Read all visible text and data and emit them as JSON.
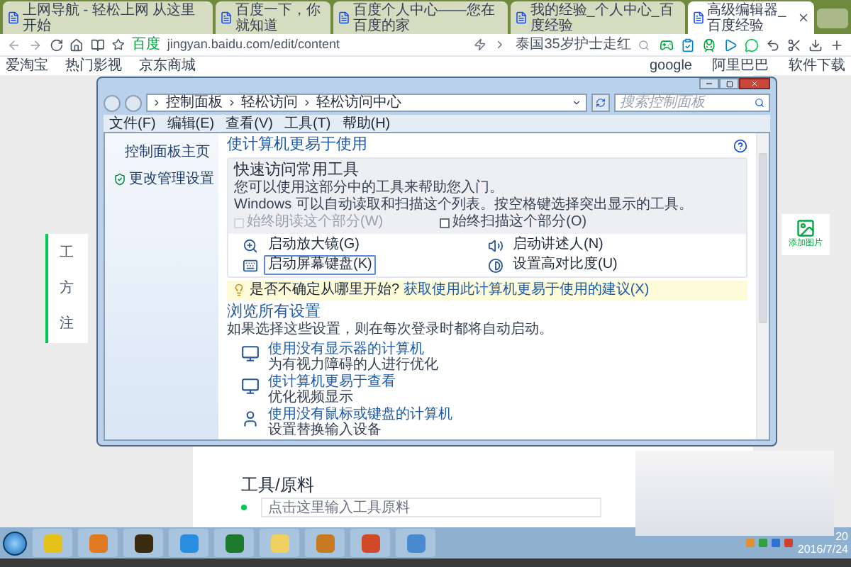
{
  "browser": {
    "tabs": [
      {
        "title": "上网导航 - 轻松上网 从这里开始",
        "selected": false
      },
      {
        "title": "百度一下，你就知道",
        "selected": false
      },
      {
        "title": "百度个人中心——您在百度的家",
        "selected": false
      },
      {
        "title": "我的经验_个人中心_百度经验",
        "selected": false
      },
      {
        "title": "高级编辑器_百度经验",
        "selected": true
      }
    ],
    "address": {
      "site_label": "百度",
      "url": "jingyan.baidu.com/edit/content"
    },
    "search": {
      "value": "泰国35岁护士走红"
    },
    "bookmarks_left": [
      "爱淘宝",
      "热门影视",
      "京东商城"
    ],
    "bookmarks_right": [
      "google",
      "阿里巴巴",
      "软件下载"
    ]
  },
  "page": {
    "side_card_items": [
      "工",
      "方",
      "注"
    ],
    "add_image": "添加图片",
    "tools_heading": "工具/原料",
    "tools_inputs": [
      {
        "placeholder": "点击这里输入工具原料"
      }
    ]
  },
  "dialog": {
    "breadcrumb": [
      "控制面板",
      "轻松访问",
      "轻松访问中心"
    ],
    "search": {
      "placeholder": "搜索控制面板"
    },
    "menu": [
      "文件(F)",
      "编辑(E)",
      "查看(V)",
      "工具(T)",
      "帮助(H)"
    ],
    "sidebar": [
      {
        "label": "控制面板主页",
        "kind": "link"
      },
      {
        "label": "更改管理设置",
        "kind": "shield"
      }
    ],
    "section_title": "使计算机更易于使用",
    "quick_access": {
      "title": "快速访问常用工具",
      "lines": [
        "您可以使用这部分中的工具来帮助您入门。",
        "Windows 可以自动读取和扫描这个列表。按空格键选择突出显示的工具。"
      ],
      "checkboxes": [
        {
          "label": "始终朗读这个部分(W)",
          "checked": false,
          "disabled": true
        },
        {
          "label": "始终扫描这个部分(O)",
          "checked": false,
          "disabled": false
        }
      ]
    },
    "tools": [
      {
        "label": "启动放大镜(G)",
        "kind": "magnifier",
        "focused": false
      },
      {
        "label": "启动讲述人(N)",
        "kind": "narrator",
        "focused": false
      },
      {
        "label": "启动屏幕键盘(K)",
        "kind": "keyboard",
        "focused": true
      },
      {
        "label": "设置高对比度(U)",
        "kind": "contrast",
        "focused": false
      }
    ],
    "tip": {
      "text": "是否不确定从哪里开始?",
      "link": "获取使用此计算机更易于使用的建议(X)"
    },
    "browse": {
      "title": "浏览所有设置",
      "description": "如果选择这些设置，则在每次登录时都将自动启动。",
      "items": [
        {
          "title": "使用没有显示器的计算机",
          "subtitle": "为有视力障碍的人进行优化",
          "kind": "monitor"
        },
        {
          "title": "使计算机更易于查看",
          "subtitle": "优化视频显示",
          "kind": "screen"
        },
        {
          "title": "使用没有鼠标或键盘的计算机",
          "subtitle": "设置替换输入设备",
          "kind": "person"
        }
      ]
    }
  },
  "taskbar": {
    "clock": {
      "time": "20",
      "date": "2016/7/24"
    }
  }
}
